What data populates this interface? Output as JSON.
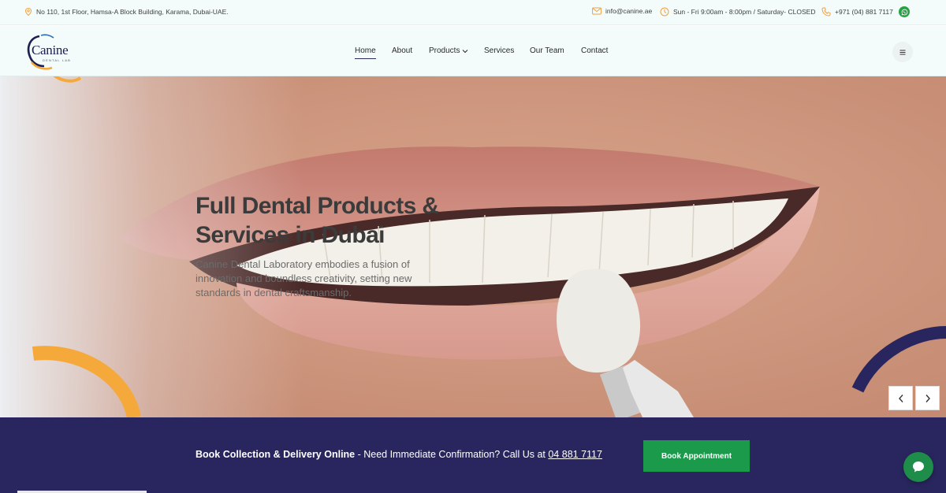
{
  "topbar": {
    "address": "No 110, 1st Floor, Hamsa-A Block Building, Karama, Dubai-UAE.",
    "email": "info@canine.ae",
    "hours": "Sun - Fri 9:00am - 8:00pm / Saturday- CLOSED",
    "phone": "+971 (04) 881 7117",
    "icons": [
      "location-pin-icon",
      "mail-icon",
      "clock-icon",
      "phone-icon",
      "whatsapp-icon"
    ]
  },
  "logo": {
    "word": "Canine",
    "sub": "DENTAL LAB"
  },
  "nav": {
    "items": [
      "Home",
      "About",
      "Products",
      "Services",
      "Our Team",
      "Contact"
    ],
    "active": "Home"
  },
  "hero": {
    "title": "Full Dental Products & Services in Dubai",
    "description": "Canine Dental Laboratory embodies a fusion of innovation and boundless creativity, setting new standards in dental craftsmanship."
  },
  "booking": {
    "lead": "Book Collection & Delivery Online",
    "text": " - Need Immediate Confirmation? Call Us at ",
    "phone": "04 881 7117",
    "button": "Book Appointment"
  },
  "colors": {
    "brand_navy": "#29265f",
    "brand_green": "#1c9a4c",
    "accent_orange": "#f6a93b",
    "icon_orange": "#f0a040"
  }
}
